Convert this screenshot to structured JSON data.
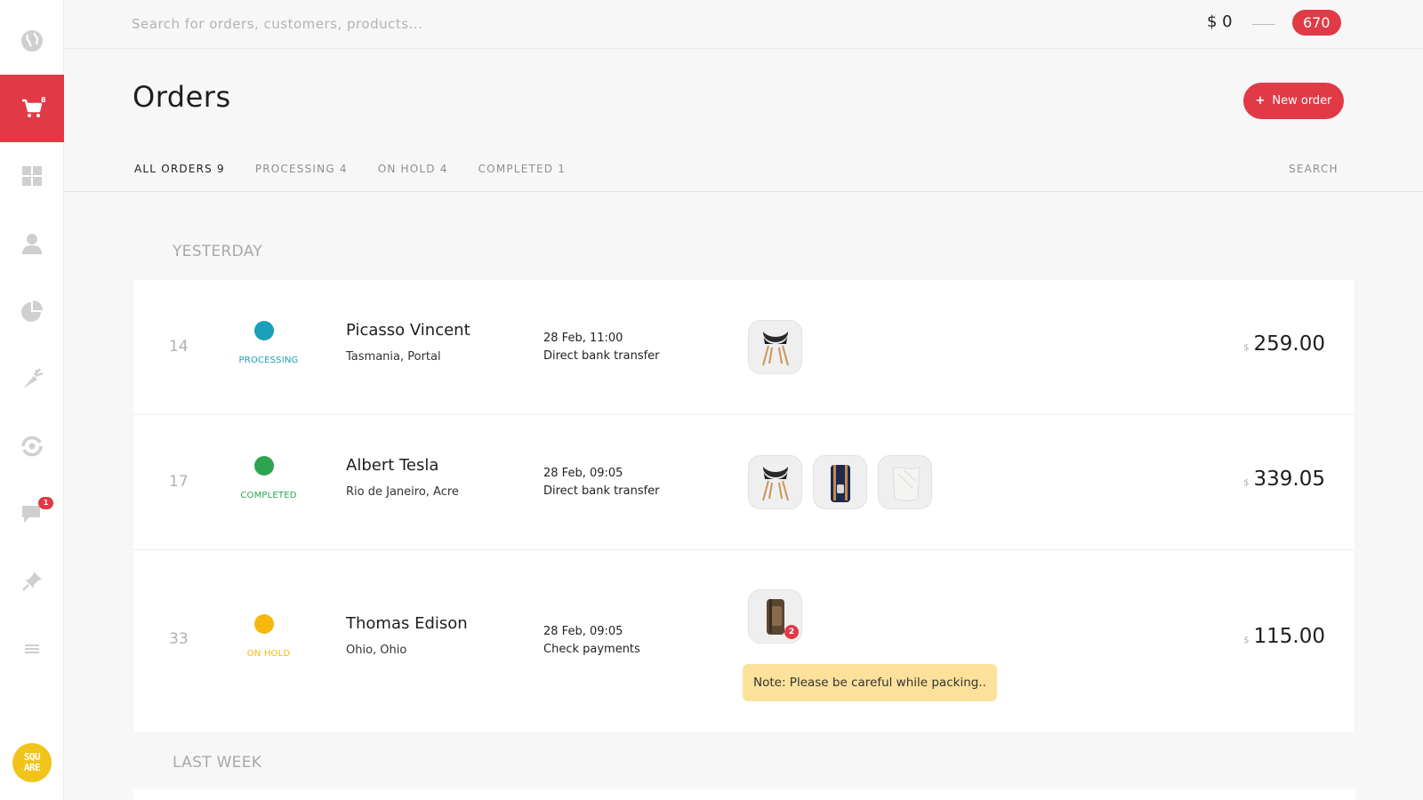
{
  "sidebar": {
    "items": [
      {
        "name": "globe",
        "icon": "globe-icon",
        "active": false
      },
      {
        "name": "orders",
        "icon": "cart-icon",
        "active": true,
        "badge": "8"
      },
      {
        "name": "dashboard",
        "icon": "grid-icon",
        "active": false
      },
      {
        "name": "customers",
        "icon": "user-icon",
        "active": false
      },
      {
        "name": "reports",
        "icon": "pie-chart-icon",
        "active": false
      },
      {
        "name": "products",
        "icon": "carrot-icon",
        "active": false
      },
      {
        "name": "integrations",
        "icon": "sync-icon",
        "active": false
      },
      {
        "name": "messages",
        "icon": "chat-icon",
        "active": false,
        "badge": "1"
      },
      {
        "name": "pinned",
        "icon": "pin-icon",
        "active": false
      },
      {
        "name": "menu",
        "icon": "menu-icon",
        "active": false
      }
    ],
    "logo_lines": [
      "SQU",
      "ARE"
    ]
  },
  "topbar": {
    "search_placeholder": "Search for orders, customers, products...",
    "balance": "$ 0",
    "points": "670"
  },
  "header": {
    "title": "Orders",
    "new_order_plus": "+",
    "new_order_label": "New order"
  },
  "tabs": [
    {
      "label": "ALL ORDERS 9",
      "active": true
    },
    {
      "label": "PROCESSING 4",
      "active": false
    },
    {
      "label": "ON HOLD 4",
      "active": false
    },
    {
      "label": "COMPLETED 1",
      "active": false
    }
  ],
  "tab_search": "SEARCH",
  "groups": [
    {
      "label": "YESTERDAY",
      "orders": [
        {
          "number": "14",
          "status": "PROCESSING",
          "status_color": "#1a9fb8",
          "name": "Picasso Vincent",
          "location": "Tasmania, Portal",
          "date": "28 Feb, 11:00",
          "payment": "Direct bank transfer",
          "products": [
            "chair-icon"
          ],
          "currency": "$",
          "total": "259.00"
        },
        {
          "number": "17",
          "status": "COMPLETED",
          "status_color": "#2ea44f",
          "name": "Albert Tesla",
          "location": "Rio de Janeiro, Acre",
          "date": "28 Feb, 09:05",
          "payment": "Direct bank transfer",
          "products": [
            "chair-icon",
            "backpack-icon",
            "paper-bag-icon"
          ],
          "currency": "$",
          "total": "339.05"
        },
        {
          "number": "33",
          "status": "ON HOLD",
          "status_color": "#f5b80f",
          "name": "Thomas Edison",
          "location": "Ohio, Ohio",
          "date": "28 Feb, 09:05",
          "payment": "Check payments",
          "products": [
            "brown-backpack-icon"
          ],
          "product_qty_badge": "2",
          "note": "Note: Please be careful while packing..",
          "currency": "$",
          "total": "115.00"
        }
      ]
    },
    {
      "label": "LAST WEEK",
      "orders": []
    }
  ],
  "colors": {
    "accent": "#e03a47",
    "processing": "#1a9fb8",
    "completed": "#2ea44f",
    "on_hold": "#f5b80f",
    "note_bg": "#fbe19a",
    "logo": "#f2c31a"
  }
}
